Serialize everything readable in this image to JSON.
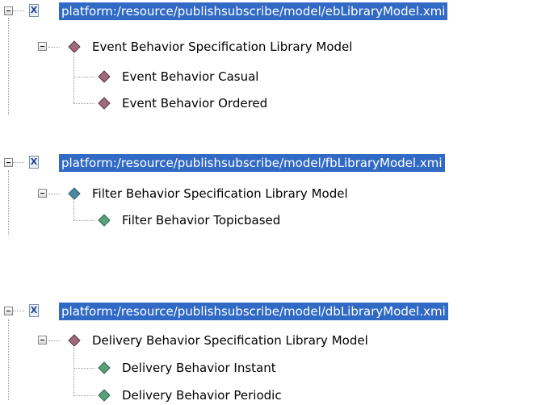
{
  "trees": [
    {
      "resource": "platform:/resource/publishsubscribe/model/ebLibraryModel.xmi",
      "model": "Event Behavior Specification Library Model",
      "children": [
        "Event Behavior Casual",
        "Event Behavior Ordered"
      ],
      "icon_color": "#a06a7a"
    },
    {
      "resource": "platform:/resource/publishsubscribe/model/fbLibraryModel.xmi",
      "model": "Filter Behavior Specification Library Model",
      "children": [
        "Filter Behavior Topicbased"
      ],
      "icon_color": "#4a8a9a"
    },
    {
      "resource": "platform:/resource/publishsubscribe/model/dbLibraryModel.xmi",
      "model": "Delivery Behavior Specification Library Model",
      "children": [
        "Delivery Behavior Instant",
        "Delivery Behavior Periodic"
      ],
      "icon_color": "#5a9a6a"
    }
  ],
  "icons": {
    "file": "xmi-file-icon",
    "file_glyph": "X",
    "element": "diamond-icon",
    "expander": "collapse-icon"
  },
  "colors": {
    "selection_background": "#316ac5",
    "selection_text": "#ffffff"
  }
}
